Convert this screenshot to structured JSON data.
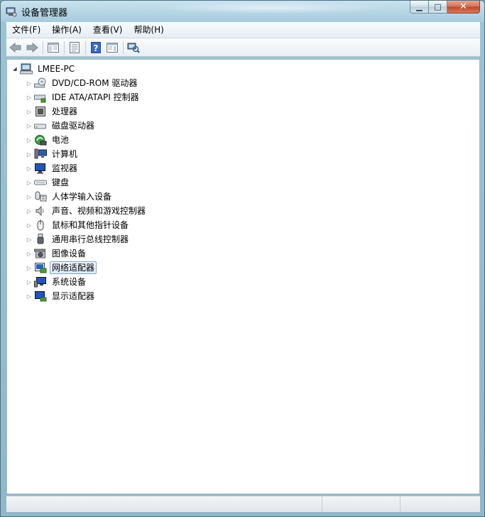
{
  "window": {
    "title": "设备管理器",
    "icon": "device-manager-icon"
  },
  "caption_buttons": {
    "minimize_glyph": "▁",
    "maximize_glyph": "□",
    "close_glyph": "✕"
  },
  "menu": {
    "items": [
      "文件(F)",
      "操作(A)",
      "查看(V)",
      "帮助(H)"
    ]
  },
  "toolbar": {
    "buttons": [
      "back-icon",
      "forward-icon",
      "show-hide-console-tree-icon",
      "properties-icon",
      "help-icon",
      "show-action-pane-icon",
      "scan-hardware-icon"
    ]
  },
  "tree": {
    "root": {
      "label": "LMEE-PC",
      "expander": "◢",
      "icon": "computer-icon"
    },
    "children": [
      {
        "label": "DVD/CD-ROM 驱动器",
        "icon": "dvd-drive-icon"
      },
      {
        "label": "IDE ATA/ATAPI 控制器",
        "icon": "ide-controller-icon"
      },
      {
        "label": "处理器",
        "icon": "processor-icon"
      },
      {
        "label": "磁盘驱动器",
        "icon": "disk-drive-icon"
      },
      {
        "label": "电池",
        "icon": "battery-icon"
      },
      {
        "label": "计算机",
        "icon": "computer-icon"
      },
      {
        "label": "监视器",
        "icon": "monitor-icon"
      },
      {
        "label": "键盘",
        "icon": "keyboard-icon"
      },
      {
        "label": "人体学输入设备",
        "icon": "hid-icon"
      },
      {
        "label": "声音、视频和游戏控制器",
        "icon": "sound-icon"
      },
      {
        "label": "鼠标和其他指针设备",
        "icon": "mouse-icon"
      },
      {
        "label": "通用串行总线控制器",
        "icon": "usb-icon"
      },
      {
        "label": "图像设备",
        "icon": "camera-icon"
      },
      {
        "label": "网络适配器",
        "icon": "network-adapter-icon",
        "selected": true
      },
      {
        "label": "系统设备",
        "icon": "system-device-icon"
      },
      {
        "label": "显示适配器",
        "icon": "display-adapter-icon"
      }
    ],
    "collapsed_expander": "▷"
  },
  "colors": {
    "accent": "#3a6ea5",
    "selection_border": "#7da2ce"
  }
}
